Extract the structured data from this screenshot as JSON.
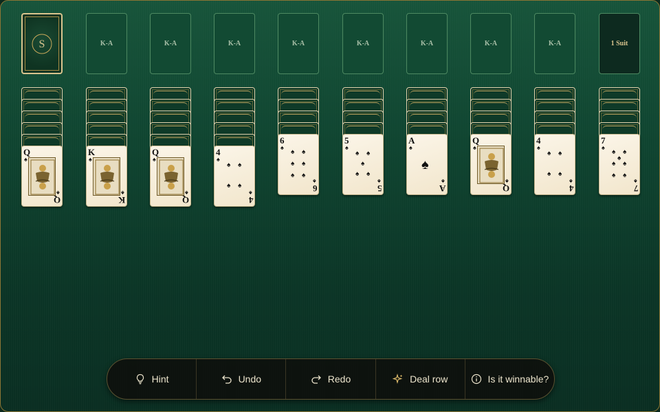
{
  "stock": {
    "emblem_name": "solitaire-seal-icon"
  },
  "foundations": [
    "K-A",
    "K-A",
    "K-A",
    "K-A",
    "K-A",
    "K-A",
    "K-A",
    "K-A"
  ],
  "difficulty": {
    "label": "1 Suit"
  },
  "tableau": [
    {
      "face_down": 5,
      "top": {
        "rank": "Q",
        "suit": "♠",
        "kind": "face"
      }
    },
    {
      "face_down": 5,
      "top": {
        "rank": "K",
        "suit": "♠",
        "kind": "face"
      }
    },
    {
      "face_down": 5,
      "top": {
        "rank": "Q",
        "suit": "♠",
        "kind": "face"
      }
    },
    {
      "face_down": 5,
      "top": {
        "rank": "4",
        "suit": "♠",
        "kind": "pips"
      }
    },
    {
      "face_down": 4,
      "top": {
        "rank": "6",
        "suit": "♠",
        "kind": "pips"
      }
    },
    {
      "face_down": 4,
      "top": {
        "rank": "5",
        "suit": "♠",
        "kind": "pips"
      }
    },
    {
      "face_down": 4,
      "top": {
        "rank": "A",
        "suit": "♠",
        "kind": "ace"
      }
    },
    {
      "face_down": 4,
      "top": {
        "rank": "Q",
        "suit": "♠",
        "kind": "face"
      }
    },
    {
      "face_down": 4,
      "top": {
        "rank": "4",
        "suit": "♠",
        "kind": "pips"
      }
    },
    {
      "face_down": 4,
      "top": {
        "rank": "7",
        "suit": "♠",
        "kind": "pips"
      }
    }
  ],
  "toolbar": {
    "hint": "Hint",
    "undo": "Undo",
    "redo": "Redo",
    "deal_row": "Deal row",
    "winnable": "Is it winnable?"
  },
  "colors": {
    "felt": "#0f4430",
    "gold": "#d9c48e",
    "card_face": "#f7efdd"
  }
}
